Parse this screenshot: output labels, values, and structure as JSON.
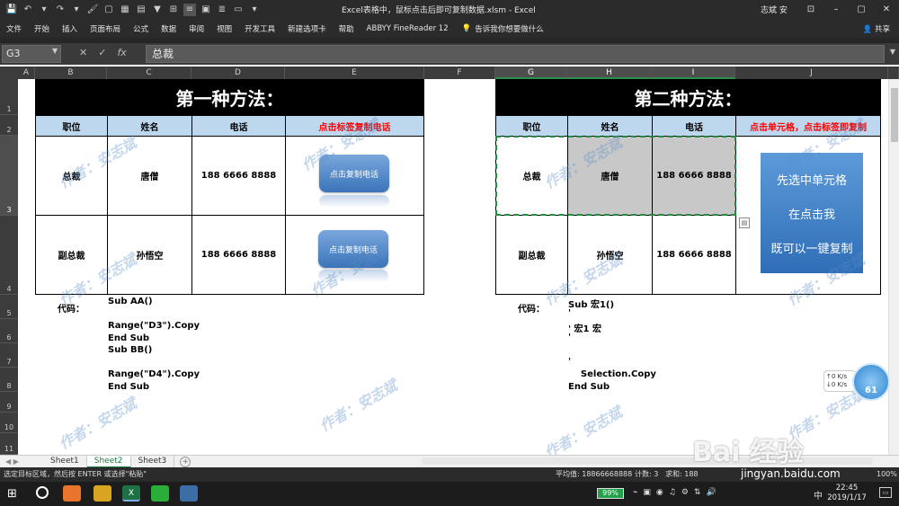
{
  "window": {
    "title": "Excel表格中，鼠标点击后即可复制数据.xlsm - Excel",
    "user": "志斌 安",
    "controls": [
      "⊡",
      "–",
      "▢",
      "✕"
    ]
  },
  "quick_access": [
    "💾",
    "↶",
    "▾",
    "↷",
    "▾",
    "🖌",
    "▢",
    "▦",
    "▤",
    "▼",
    "⊞",
    "≡",
    "▣",
    "≣",
    "▭",
    "▾"
  ],
  "menu": {
    "items": [
      "文件",
      "开始",
      "插入",
      "页面布局",
      "公式",
      "数据",
      "审阅",
      "视图",
      "开发工具",
      "新建选项卡",
      "帮助",
      "ABBYY FineReader 12"
    ],
    "tell_me": "告诉我你想要做什么",
    "share": "共享"
  },
  "formula_bar": {
    "name_box": "G3",
    "formula": "总裁",
    "cancel": "✕",
    "enter": "✓",
    "fx": "fx"
  },
  "columns": [
    "A",
    "B",
    "C",
    "D",
    "E",
    "F",
    "G",
    "H",
    "I",
    "J"
  ],
  "rows": [
    "1",
    "2",
    "3",
    "4",
    "5",
    "6",
    "7",
    "8",
    "9",
    "10",
    "11"
  ],
  "table1": {
    "title": "第一种方法：",
    "headers": [
      "职位",
      "姓名",
      "电话",
      "点击标签复制电话"
    ],
    "rows": [
      [
        "总裁",
        "唐僧",
        "188 6666 8888"
      ],
      [
        "副总裁",
        "孙悟空",
        "188 6666 8888"
      ]
    ],
    "button_label": "点击复制电话"
  },
  "table2": {
    "title": "第二种方法：",
    "headers": [
      "职位",
      "姓名",
      "电话",
      "点击单元格，点击标签即复制"
    ],
    "rows": [
      [
        "总裁",
        "唐僧",
        "188 6666 8888"
      ],
      [
        "副总裁",
        "孙悟空",
        "188 6666 8888"
      ]
    ],
    "big_button_lines": [
      "先选中单元格",
      "在点击我",
      "既可以一键复制"
    ]
  },
  "code1": {
    "label": "代码：",
    "lines": [
      "Sub AA()",
      "",
      "Range(\"D3\").Copy",
      "End Sub",
      "Sub BB()",
      "",
      "Range(\"D4\").Copy",
      "End Sub"
    ]
  },
  "code2": {
    "label": "代码：",
    "lines": [
      "Sub 宏1()",
      "'",
      "' 宏1 宏",
      "'",
      "",
      "'",
      "    Selection.Copy",
      "End Sub"
    ]
  },
  "watermark": "作者：安志斌",
  "sheet_tabs": {
    "nav": "◀ ▶",
    "tabs": [
      "Sheet1",
      "Sheet2",
      "Sheet3"
    ],
    "active": "Sheet2",
    "add": "+"
  },
  "status": {
    "message": "选定目标区域，然后按 ENTER 或选择\"粘贴\"",
    "average": "平均值: 18866668888",
    "count": "计数: 3",
    "sum": "求和: 188",
    "zoom": "100%"
  },
  "floating": {
    "up_speed": "0 K/s",
    "down_speed": "0 K/s",
    "ball_value": "61"
  },
  "taskbar": {
    "battery": "99%",
    "ime": "中",
    "time": "22:45",
    "date": "2019/1/17",
    "notif": "▭"
  },
  "watermark_site": {
    "logo": "Bai 经验",
    "url": "jingyan.baidu.com"
  }
}
